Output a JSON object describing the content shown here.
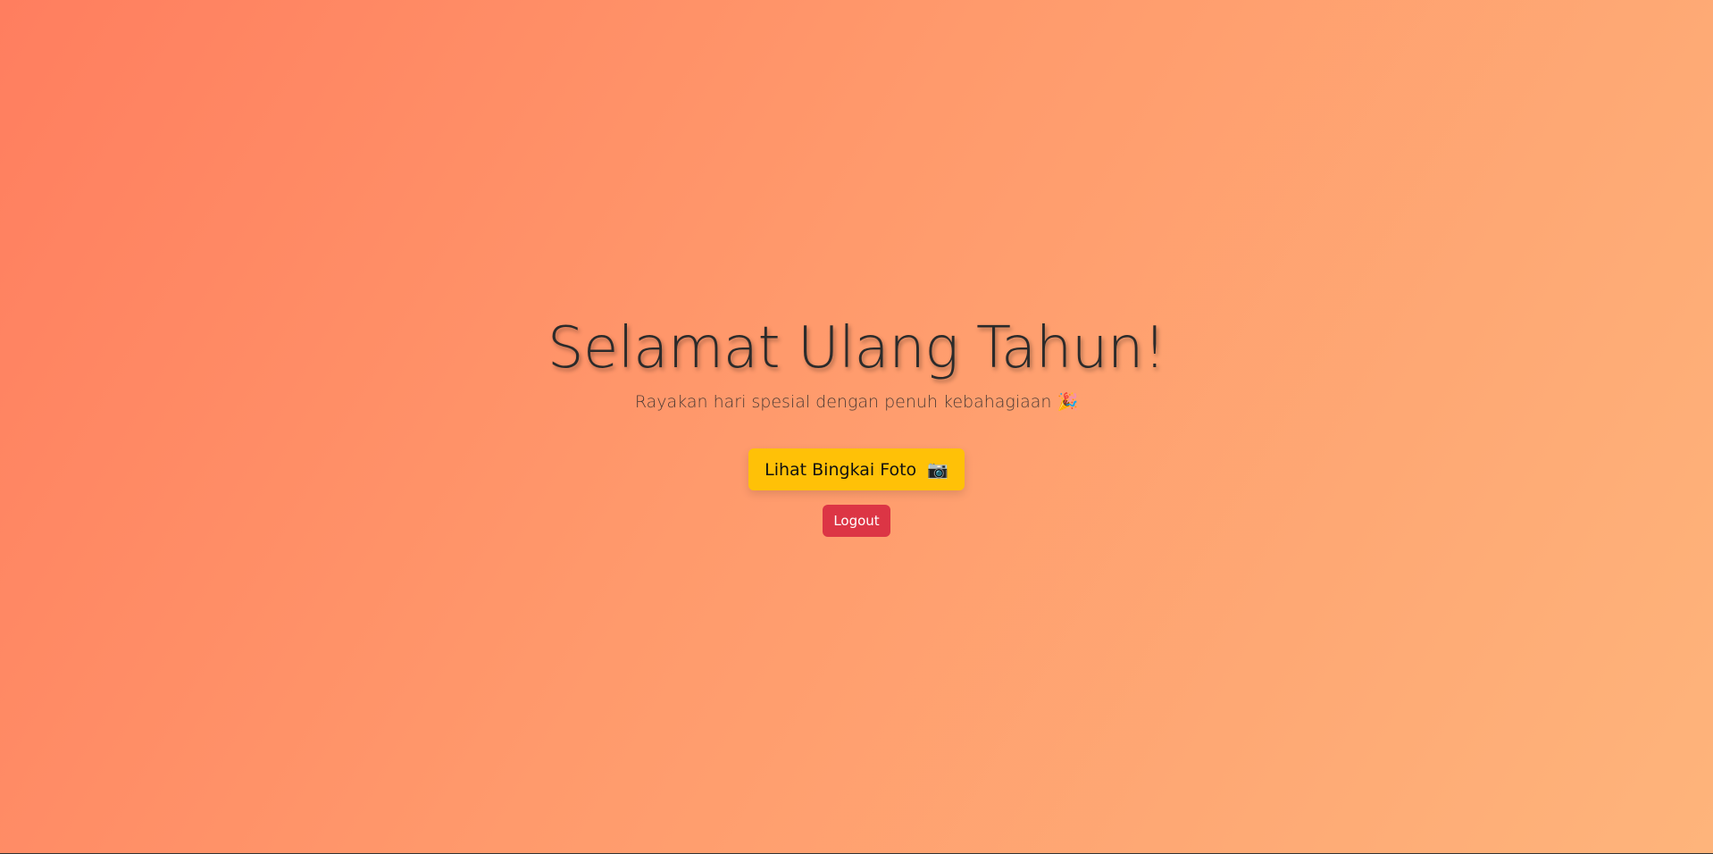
{
  "hero": {
    "title": "Selamat Ulang Tahun!",
    "subtitle": "Rayakan hari spesial dengan penuh kebahagiaan",
    "subtitle_emoji": "🎉"
  },
  "actions": {
    "photo_button_label": "Lihat Bingkai Foto",
    "photo_button_emoji": "📷",
    "logout_label": "Logout"
  },
  "colors": {
    "background_start": "#ff7e5f",
    "background_end": "#feb47b",
    "photo_button": "#ffc107",
    "logout_button": "#dc3545"
  },
  "icons": {
    "subtitle_icon": "party-popper-icon",
    "photo_icon": "camera-icon"
  }
}
